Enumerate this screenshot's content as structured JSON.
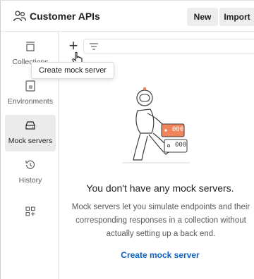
{
  "header": {
    "workspace_title": "Customer APIs",
    "new_label": "New",
    "import_label": "Import"
  },
  "sidebar": {
    "items": [
      {
        "label": "Collections",
        "icon": "collections-icon",
        "active": false
      },
      {
        "label": "Environments",
        "icon": "environments-icon",
        "active": false
      },
      {
        "label": "Mock servers",
        "icon": "mock-servers-icon",
        "active": true
      },
      {
        "label": "History",
        "icon": "history-icon",
        "active": false
      },
      {
        "label": "",
        "icon": "add-widget-icon",
        "active": false
      }
    ]
  },
  "toolbar": {
    "add_symbol": "+",
    "add_tooltip": "Create mock server"
  },
  "empty_state": {
    "title": "You don't have any mock servers.",
    "description": "Mock servers let you simulate endpoints and their corresponding responses in a collection without actually setting up a back end.",
    "action_label": "Create mock server",
    "illustration_label": "000"
  },
  "colors": {
    "accent_link": "#0b61c4",
    "server_orange": "#f0845a",
    "active_nav_bg": "#ebebeb"
  }
}
